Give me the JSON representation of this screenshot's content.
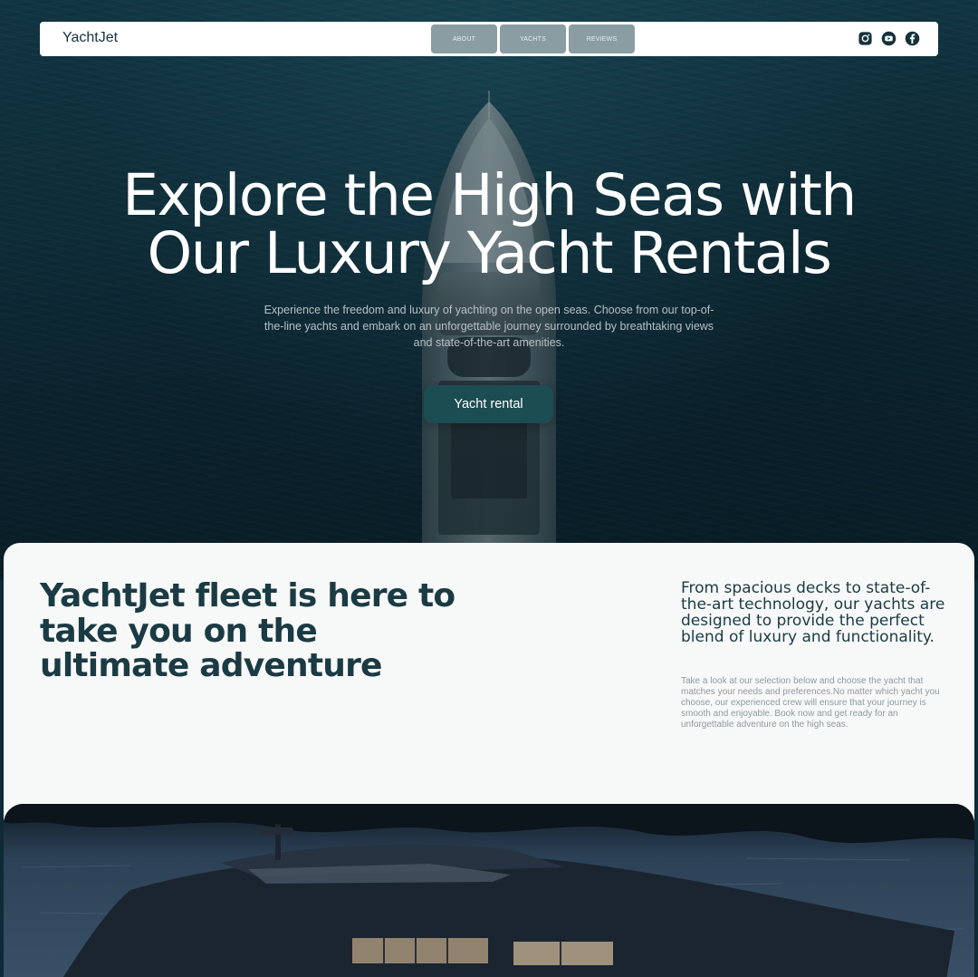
{
  "nav": {
    "brand": "YachtJet",
    "links": [
      "ABOUT",
      "YACHTS",
      "REVIEWS"
    ],
    "social_icons": [
      "instagram-icon",
      "youtube-icon",
      "facebook-icon"
    ]
  },
  "hero": {
    "title": "Explore the High Seas with Our Luxury Yacht Rentals",
    "subtitle": "Experience the freedom and luxury of yachting on the open seas. Choose from our top-of-the-line yachts and embark on an unforgettable journey surrounded by breathtaking views and state-of-the-art amenities.",
    "cta_label": "Yacht rental"
  },
  "fleet": {
    "title": "YachtJet fleet is here to take you on the ultimate adventure",
    "lead": "From spacious decks to state-of-the-art technology, our yachts are designed to provide the perfect blend of luxury and functionality.",
    "body": "Take a look at our selection below and choose the yacht that matches your needs and preferences.No matter which yacht you choose, our experienced crew will ensure that your journey is smooth and enjoyable. Book now and get ready for an unforgettable adventure on the high seas."
  },
  "colors": {
    "hero_bg": "#0f2f3b",
    "nav_button": "#8a9da2",
    "cta": "#1c4d53",
    "heading": "#1b3b44",
    "muted_text": "#8f9a9e",
    "section_bg": "#f7f8f8"
  }
}
